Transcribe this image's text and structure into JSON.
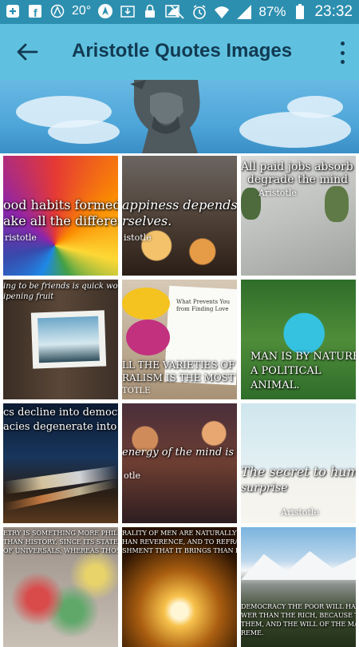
{
  "status_bar": {
    "temperature": "20°",
    "battery": "87%",
    "time": "23:32"
  },
  "app_bar": {
    "title": "Aristotle Quotes Images",
    "back_icon": "arrow-left-icon",
    "menu_icon": "more-vert-icon"
  },
  "grid": {
    "tiles": [
      {
        "quote": "ood habits formed at you",
        "quote2": "ake all the difference",
        "author": "ristotle"
      },
      {
        "quote": "appiness depends up",
        "quote2": "rselves.",
        "author": "istotle"
      },
      {
        "quote": "All paid jobs absorb and",
        "quote2": "degrade the mind",
        "author": "Aristotle"
      },
      {
        "quote": "ing to be friends is quick work but friendship",
        "quote2": "ipening fruit",
        "author": ""
      },
      {
        "quote": "LL THE VARIETIES OF VIR",
        "quote2": "RALISM IS THE MOST BEL",
        "author": "TOTLE",
        "card_title": "What Prevents You from Finding Love"
      },
      {
        "quote": "MAN IS BY NATURE",
        "quote2": "A POLITICAL",
        "quote3": "ANIMAL.",
        "author": ""
      },
      {
        "quote": "cs decline into democracie",
        "quote2": "acies degenerate into des",
        "author": ""
      },
      {
        "quote": "energy of the mind is the ess",
        "quote2": "",
        "author": "otle"
      },
      {
        "quote": "The secret to humor is",
        "quote2": "surprise",
        "author": "Aristotle"
      },
      {
        "quote": "ETRY IS SOMETHING MORE PHILOSOPHIC AND O",
        "quote2": "THAN HISTORY, SINCE ITS STATEMENTS ARE",
        "quote3": "OF UNIVERSALS, WHEREAS THOSE OF HISTORY A",
        "author": ""
      },
      {
        "quote": "RALITY OF MEN ARE NATURALLY APT TO BE SWAYED BY",
        "quote2": "HAN REVERENCE, AND TO REFRAIN FROM EVIL RATHER",
        "quote3": "SHMENT THAT IT BRINGS THAN BECAUSE OF ITS OWN F",
        "author": ""
      },
      {
        "quote": "DEMOCRACY THE POOR WILL HAVE MORE",
        "quote2": "WER THAN THE RICH, BECAUSE THERE ARE",
        "quote3": "THEM, AND THE WILL OF THE MAJORITY IS",
        "quote4": "REME.",
        "author": ""
      }
    ]
  }
}
